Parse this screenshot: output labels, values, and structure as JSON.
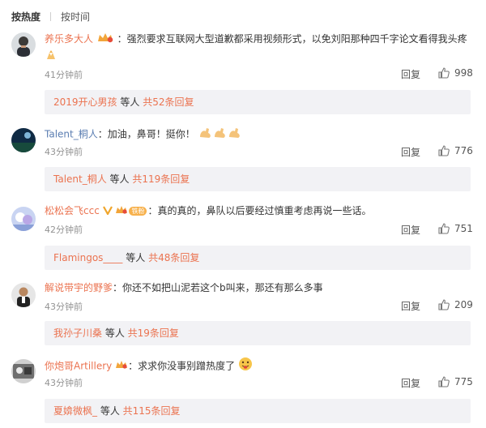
{
  "sort": {
    "hot_label": "按热度",
    "time_label": "按时间"
  },
  "comments": [
    {
      "user": "养乐多大人",
      "text": "：强烈要求互联网大型道歉都采用视频形式，以免刘阳那种四千字论文看得我头疼",
      "time": "41分钟前",
      "reply_label": "回复",
      "likes": "998",
      "sub_reply": {
        "who": "2019开心男孩",
        "mid": " 等人 ",
        "total": "共52条回复"
      }
    },
    {
      "user": "Talent_桐人",
      "text": "：加油，鼻哥！挺你！",
      "time": "43分钟前",
      "reply_label": "回复",
      "likes": "776",
      "sub_reply": {
        "who": "Talent_桐人",
        "mid": " 等人 ",
        "total": "共119条回复"
      }
    },
    {
      "user": "松松会飞ccc",
      "text": "：真的真的，鼻队以后要经过慎重考虑再说一些话。",
      "vip_tag": "铁粉",
      "time": "42分钟前",
      "reply_label": "回复",
      "likes": "751",
      "sub_reply": {
        "who": "Flamingos____",
        "mid": " 等人 ",
        "total": "共48条回复"
      }
    },
    {
      "user": "解说带宇的野爹",
      "text": "：你还不如把山泥若这个b叫来，那还有那么多事",
      "time": "43分钟前",
      "reply_label": "回复",
      "likes": "209",
      "sub_reply": {
        "who": "我孙子川桑",
        "mid": " 等人 ",
        "total": "共19条回复"
      }
    },
    {
      "user": "你炮哥Artillery",
      "text": "：求求你没事别蹭热度了",
      "time": "43分钟前",
      "reply_label": "回复",
      "likes": "775",
      "sub_reply": {
        "who": "夏媕微枫_",
        "mid": " 等人 ",
        "total": "共115条回复"
      }
    }
  ]
}
